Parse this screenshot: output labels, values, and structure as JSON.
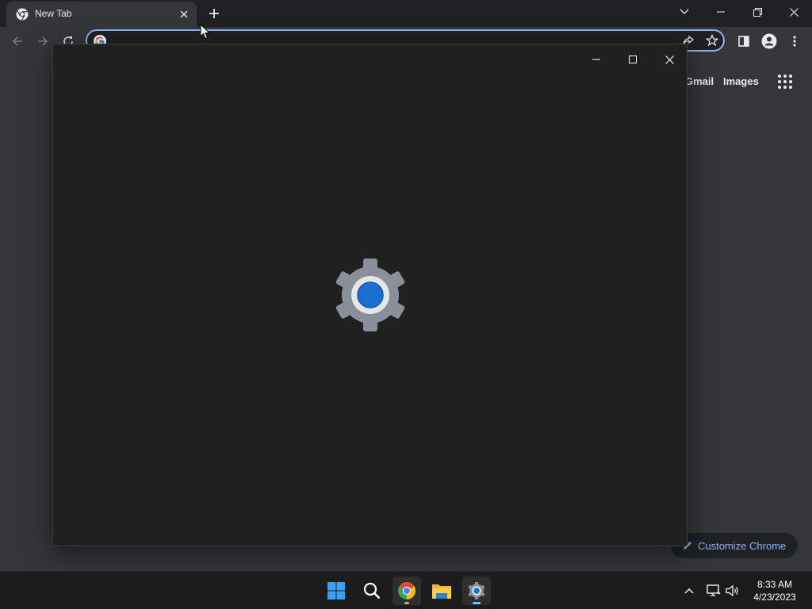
{
  "browser": {
    "tab": {
      "title": "New Tab"
    },
    "omnibox": {
      "value": "",
      "placeholder": ""
    },
    "ntp": {
      "links": [
        "Gmail",
        "Images"
      ],
      "customize_label": "Customize Chrome"
    }
  },
  "splash": {
    "app_icon": "settings-gear-icon",
    "accent": "#1a6fd1"
  },
  "taskbar": {
    "apps": [
      "start",
      "search",
      "chrome",
      "file-explorer",
      "settings"
    ],
    "clock": {
      "time": "8:33 AM",
      "date": "4/23/2023"
    }
  },
  "colors": {
    "chrome_bg": "#35363a",
    "tabstrip_bg": "#202124",
    "omnibox_focus": "#8ab4f8",
    "splash_bg": "#202020",
    "taskbar_bg": "#1c1c1c"
  }
}
